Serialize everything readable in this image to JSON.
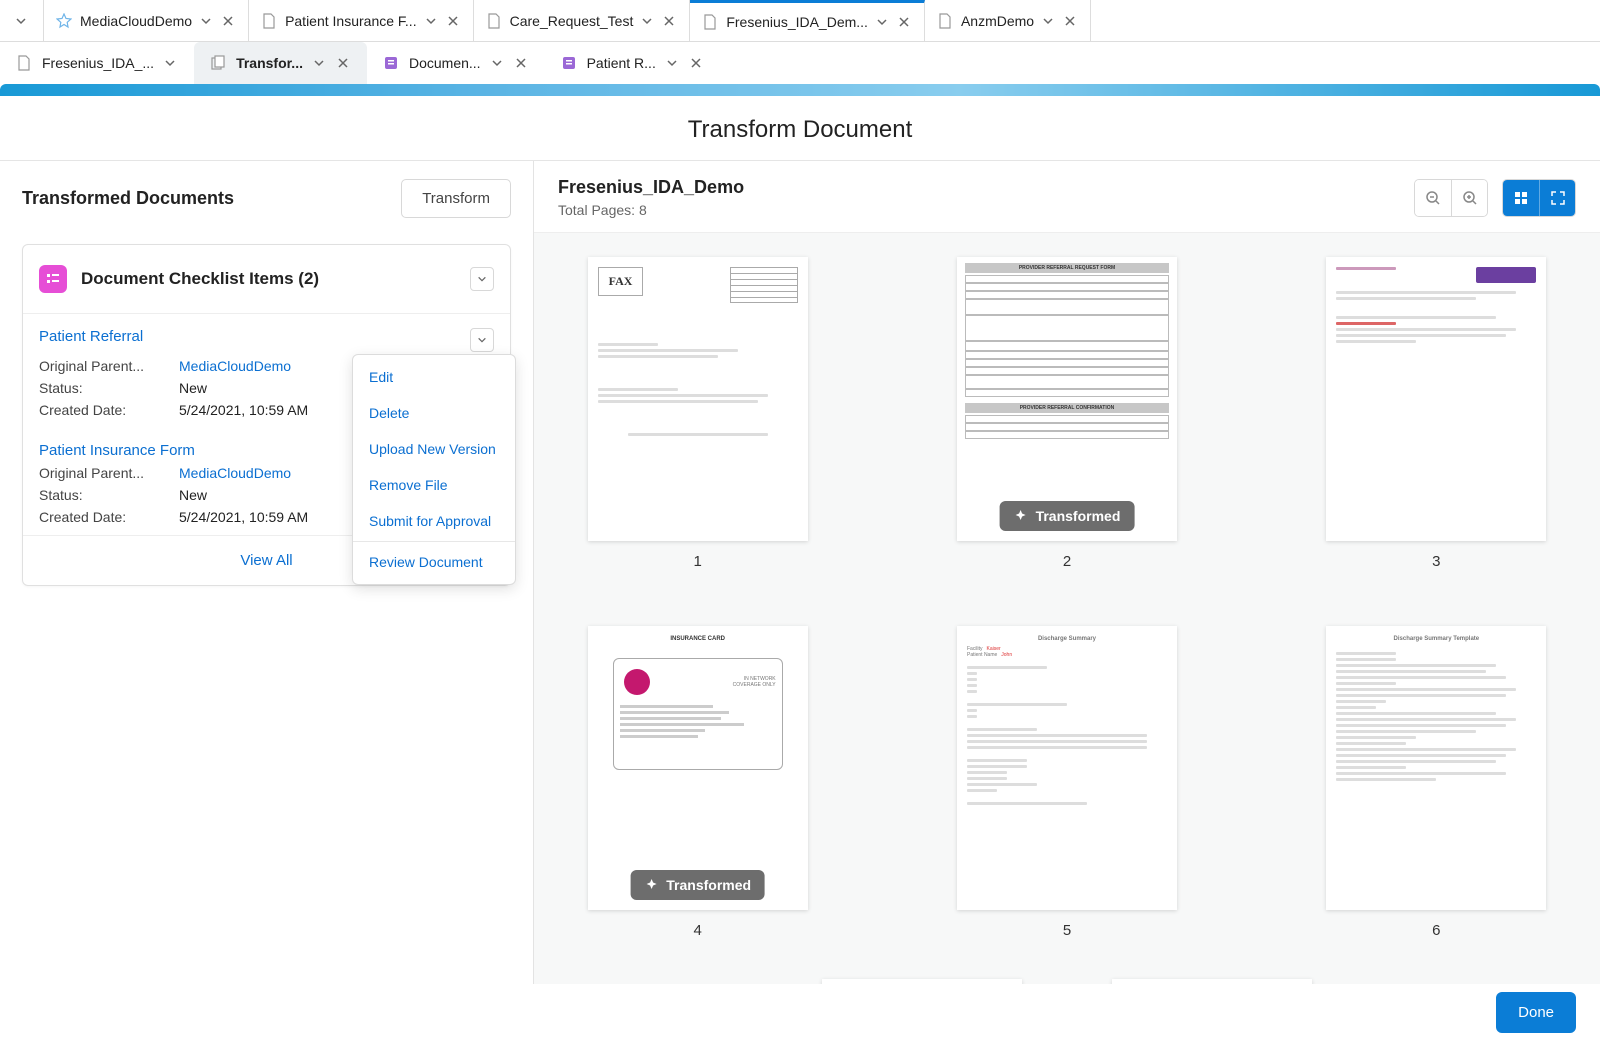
{
  "top_tabs": [
    {
      "label": "MediaCloudDemo",
      "icon": "star"
    },
    {
      "label": "Patient Insurance F...",
      "icon": "doc"
    },
    {
      "label": "Care_Request_Test",
      "icon": "doc"
    },
    {
      "label": "Fresenius_IDA_Dem...",
      "icon": "doc",
      "active": true
    },
    {
      "label": "AnzmDemo",
      "icon": "doc"
    }
  ],
  "sub_tabs": [
    {
      "label": "Fresenius_IDA_...",
      "icon": "doc"
    },
    {
      "label": "Transfor...",
      "icon": "doc2",
      "active": true
    },
    {
      "label": "Documen...",
      "icon": "record"
    },
    {
      "label": "Patient R...",
      "icon": "record"
    }
  ],
  "page_title": "Transform Document",
  "left": {
    "title": "Transformed Documents",
    "transform_btn": "Transform",
    "card_title": "Document Checklist Items (2)",
    "items": [
      {
        "title": "Patient Referral",
        "parent_label": "Original Parent...",
        "parent_value": "MediaCloudDemo",
        "status_label": "Status:",
        "status_value": "New",
        "date_label": "Created Date:",
        "date_value": "5/24/2021, 10:59 AM"
      },
      {
        "title": "Patient Insurance Form",
        "parent_label": "Original Parent...",
        "parent_value": "MediaCloudDemo",
        "status_label": "Status:",
        "status_value": "New",
        "date_label": "Created Date:",
        "date_value": "5/24/2021, 10:59 AM"
      }
    ],
    "view_all": "View All",
    "menu": {
      "edit": "Edit",
      "delete": "Delete",
      "upload": "Upload New Version",
      "remove": "Remove File",
      "submit": "Submit for Approval",
      "review": "Review Document"
    }
  },
  "right": {
    "title": "Fresenius_IDA_Demo",
    "pages_label": "Total Pages: 8",
    "transformed_badge": "Transformed",
    "page_numbers": [
      "1",
      "2",
      "3",
      "4",
      "5",
      "6"
    ]
  },
  "footer": {
    "done": "Done"
  }
}
